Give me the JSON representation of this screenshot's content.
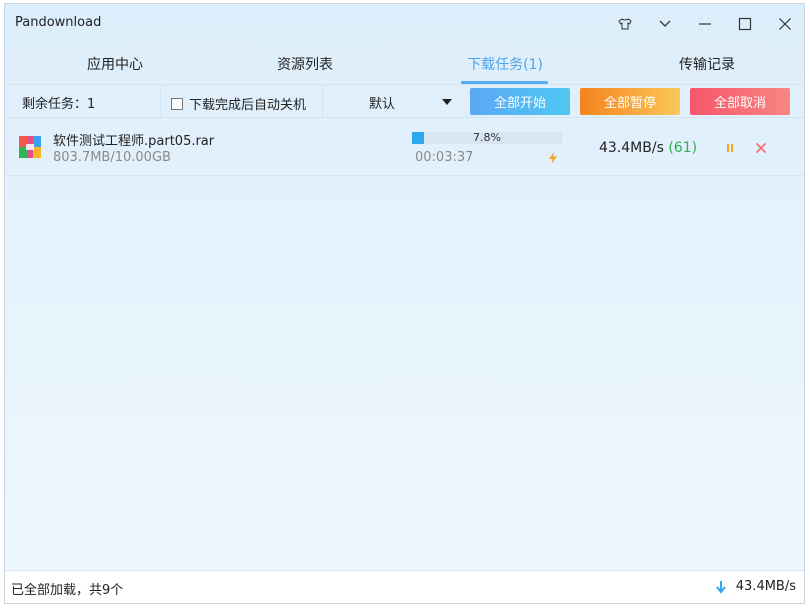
{
  "window": {
    "title": "Pandownload"
  },
  "colors": {
    "accent": "#4fa3e6",
    "progress": "#2fa7ee",
    "connections": "#2bb24c",
    "pause_icon": "#f5a623",
    "cancel_icon": "#f26b6b"
  },
  "tabs": [
    {
      "label": "应用中心"
    },
    {
      "label": "资源列表"
    },
    {
      "label": "下载任务(1)"
    },
    {
      "label": "传输记录"
    }
  ],
  "toolbar": {
    "remaining": "剩余任务：1",
    "auto_shutdown_label": "下载完成后自动关机",
    "auto_shutdown_checked": false,
    "sort_value": "默认",
    "start_all": "全部开始",
    "pause_all": "全部暂停",
    "cancel_all": "全部取消"
  },
  "downloads": [
    {
      "name": "软件测试工程师.part05.rar",
      "size": "803.7MB/10.00GB",
      "progress_text": "7.8%",
      "progress": 0.078,
      "elapsed": "00:03:37",
      "speed": "43.4MB/s",
      "connections": "(61)",
      "icon": "archive-icon"
    }
  ],
  "status": {
    "left": "已全部加载，共9个",
    "speed": "43.4MB/s"
  }
}
